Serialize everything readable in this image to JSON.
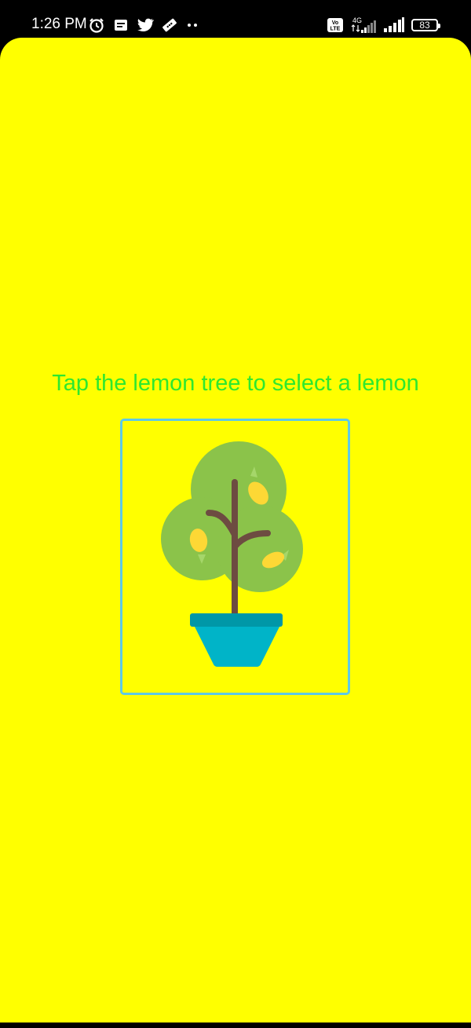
{
  "status_bar": {
    "time": "1:26 PM",
    "left_icons": [
      "alarm-icon",
      "message-icon",
      "twitter-icon",
      "ticket-icon",
      "more-notifications-icon"
    ],
    "right_icons": [
      "volte-icon",
      "signal-4g-icon",
      "signal-icon",
      "battery-icon"
    ],
    "network_label": "4G",
    "volte_label": "Vo LTE",
    "battery_level": "83"
  },
  "app": {
    "background_color": "#ffff00",
    "prompt": "Tap the lemon tree to select a lemon",
    "prompt_color": "#2ee82e",
    "image_border_color": "#5ec9e6",
    "image_icon": "lemon-tree-icon"
  }
}
